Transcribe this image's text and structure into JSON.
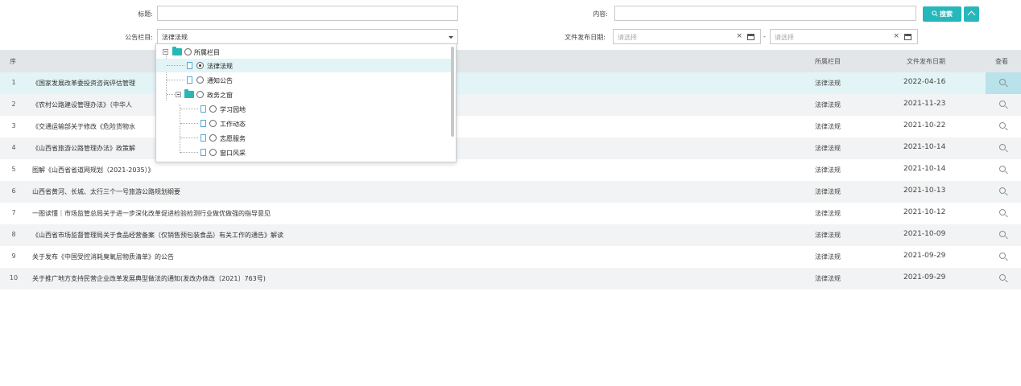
{
  "filters": {
    "title_label": "标题:",
    "title_value": "",
    "content_label": "内容:",
    "content_value": "",
    "search_button": "搜索",
    "column_label": "公告栏目:",
    "column_value": "法律法规",
    "date_label": "文件发布日期:",
    "date_from_placeholder": "请选择",
    "date_to_placeholder": "请选择",
    "date_separator": "-",
    "clear_glyph": "×"
  },
  "table": {
    "headers": {
      "no": "序",
      "column": "所属栏目",
      "date": "文件发布日期",
      "view": "查看"
    },
    "rows": [
      {
        "no": "1",
        "title": "《国家发展改革委投资咨询评估管理",
        "column": "法律法规",
        "date": "2022-04-16"
      },
      {
        "no": "2",
        "title": "《农村公路建设管理办法》（中华人",
        "column": "法律法规",
        "date": "2021-11-23"
      },
      {
        "no": "3",
        "title": "《交通运输部关于修改《危险货物水",
        "column": "法律法规",
        "date": "2021-10-22"
      },
      {
        "no": "4",
        "title": "《山西省旅游公路管理办法》政策解",
        "column": "法律法规",
        "date": "2021-10-14"
      },
      {
        "no": "5",
        "title": "图解《山西省省道网规划（2021-2035）》",
        "column": "法律法规",
        "date": "2021-10-14"
      },
      {
        "no": "6",
        "title": "山西省黄河、长城、太行三个一号旅游公路规划纲要",
        "column": "法律法规",
        "date": "2021-10-13"
      },
      {
        "no": "7",
        "title": "一图读懂｜市场监管总局关于进一步深化改革促进检验检测行业做优做强的指导意见",
        "column": "法律法规",
        "date": "2021-10-12"
      },
      {
        "no": "8",
        "title": "《山西省市场监督管理局关于食品经营备案（仅销售预包装食品）有关工作的通告》解读",
        "column": "法律法规",
        "date": "2021-10-09"
      },
      {
        "no": "9",
        "title": "关于发布《中国受控消耗臭氧层物质清单》的公告",
        "column": "法律法规",
        "date": "2021-09-29"
      },
      {
        "no": "10",
        "title": "关于推广地方支持民营企业改革发展典型做法的通知(发改办体改〔2021〕763号)",
        "column": "法律法规",
        "date": "2021-09-29"
      }
    ]
  },
  "tree": {
    "root": "所属栏目",
    "n1": "法律法规",
    "n2": "通知公告",
    "n3": "政务之窗",
    "n3_1": "学习园地",
    "n3_2": "工作动态",
    "n3_3": "志愿服务",
    "n3_4": "窗口风采"
  }
}
